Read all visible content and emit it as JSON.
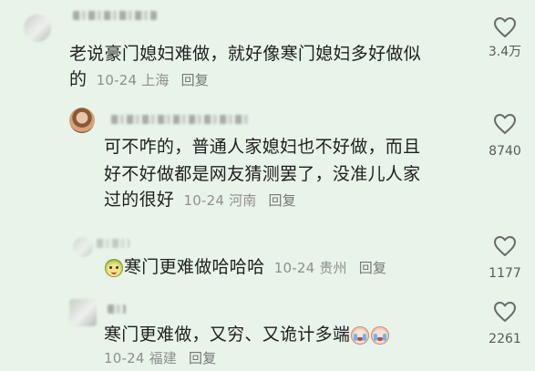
{
  "comments": [
    {
      "text_line1": "老说豪门媳妇难做，就好像寒门媳妇多好做似",
      "text_line2_prefix": "的",
      "date": "10-24",
      "location": "上海",
      "reply_label": "回复",
      "likes": "3.4万"
    },
    {
      "text_line1": "可不咋的，普通人家媳妇也不好做，而且",
      "text_line2": "好不好做都是网友猜测罢了，没准儿人家",
      "text_line3_prefix": "过的很好",
      "date": "10-24",
      "location": "河南",
      "reply_label": "回复",
      "likes": "8740"
    },
    {
      "emoji": "lime-face-emoji",
      "text": "寒门更难做哈哈哈",
      "date": "10-24",
      "location": "贵州",
      "reply_label": "回复",
      "likes": "1177"
    },
    {
      "text": "寒门更难做，又穷、又诡计多端",
      "emoji": "crying-face-emoji",
      "date": "10-24",
      "location": "福建",
      "reply_label": "回复",
      "likes": "2261"
    }
  ],
  "icons": {
    "like": "heart-outline-icon"
  },
  "colors": {
    "background": "#e8f3e9",
    "text": "#1f1f1f",
    "meta": "#8f8f8f"
  }
}
